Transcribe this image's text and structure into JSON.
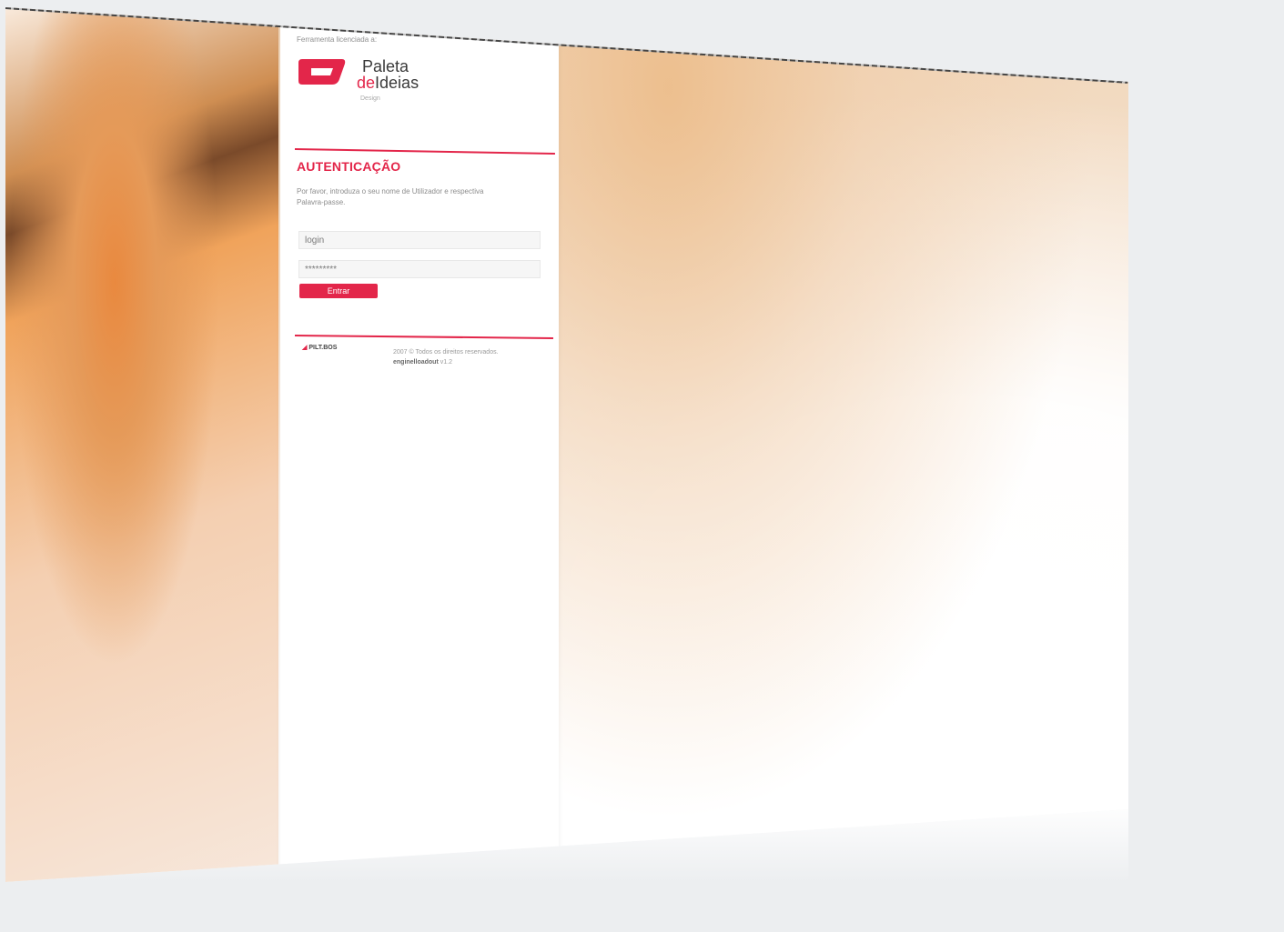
{
  "panel": {
    "supplied_by": "Ferramenta licenciada a:",
    "logo": {
      "line1": "Paleta",
      "line2_prefix": "de",
      "line2_main": "Ideias",
      "subtitle": "Design"
    },
    "title": "AUTENTICAÇÃO",
    "description": "Por favor, introduza o seu nome de Utilizador e respectiva Palavra-passe.",
    "login_value": "login",
    "password_value": "*********",
    "submit_label": "Entrar",
    "footer": {
      "brand": "PILT.BOS",
      "copyright": "2007 © Todos os direitos reservados.",
      "version_name": "enginelloadout",
      "version_num": "v1.2"
    }
  },
  "colors": {
    "accent": "#e3264a",
    "panel_bg": "#ffffff",
    "page_bg": "#eceef0"
  }
}
